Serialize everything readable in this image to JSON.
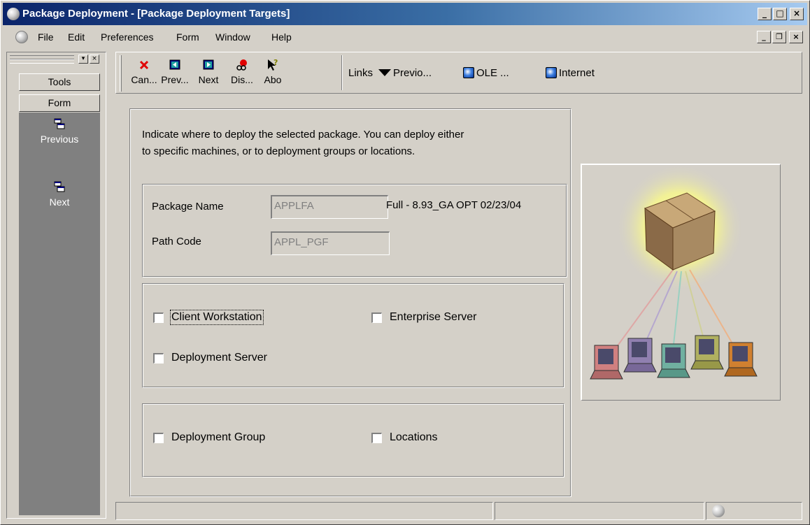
{
  "window": {
    "title": "Package Deployment - [Package Deployment Targets]",
    "controls": {
      "minimize": "_",
      "maximize": "□",
      "close": "×"
    },
    "mdi_controls": {
      "minimize": "_",
      "restore": "❐",
      "close": "×"
    }
  },
  "menubar": {
    "items": [
      "File",
      "Edit",
      "Preferences",
      "Form",
      "Window",
      "Help"
    ]
  },
  "left_panel": {
    "tools_label": "Tools",
    "form_label": "Form",
    "nav": [
      {
        "label": "Previous",
        "icon": "previous-icon"
      },
      {
        "label": "Next",
        "icon": "next-icon"
      }
    ]
  },
  "toolbar": {
    "buttons": [
      {
        "label": "Can...",
        "icon": "cancel-icon",
        "color": "#e00000"
      },
      {
        "label": "Prev...",
        "icon": "prev-icon",
        "color": "#008080"
      },
      {
        "label": "Next",
        "icon": "next-icon",
        "color": "#000080"
      },
      {
        "label": "Dis...",
        "icon": "display-icon",
        "color": "#e00000"
      },
      {
        "label": "Abo",
        "icon": "about-help-icon",
        "color": "#808000"
      }
    ],
    "links_label": "Links",
    "exits": [
      {
        "label": "Previo...",
        "icon": "arrow-down-icon"
      },
      {
        "label": "OLE ...",
        "icon": "ole-icon"
      },
      {
        "label": "Internet",
        "icon": "internet-icon"
      }
    ]
  },
  "form": {
    "instructions_line1": "Indicate where to deploy the selected package.  You can deploy either",
    "instructions_line2": "to specific machines, or to deployment groups or locations.",
    "package_name_label": "Package Name",
    "package_name_value": "APPLFA",
    "package_description": "Full - 8.93_GA OPT 02/23/04",
    "path_code_label": "Path Code",
    "path_code_value": "APPL_PGF",
    "checkboxes_machines": [
      {
        "label": "Client Workstation",
        "checked": false
      },
      {
        "label": "Enterprise Server",
        "checked": false
      },
      {
        "label": "Deployment Server",
        "checked": false
      }
    ],
    "checkboxes_groups": [
      {
        "label": "Deployment Group",
        "checked": false
      },
      {
        "label": "Locations",
        "checked": false
      }
    ]
  },
  "illustration": {
    "subject": "package-deployment-icon",
    "computer_colors": [
      "#d08080",
      "#9080b0",
      "#70b0a0",
      "#b0b060",
      "#d08030"
    ]
  },
  "colors": {
    "title_gradient_start": "#0a246a",
    "title_gradient_end": "#a6caf0",
    "face": "#d4d0c8",
    "left_panel_body": "#808080"
  }
}
